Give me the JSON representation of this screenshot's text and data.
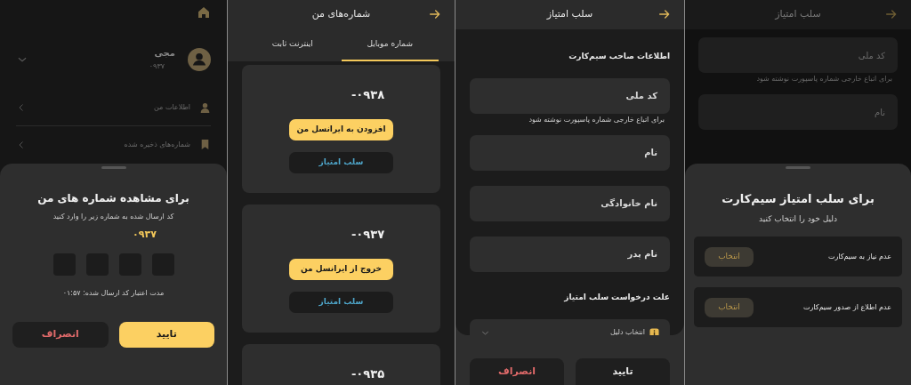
{
  "otp_screen": {
    "profile": {
      "name": "مجی",
      "phone": "۰۹۳۷"
    },
    "menu": [
      {
        "label": "اطلاعات من",
        "kind": "person"
      },
      {
        "label": "شماره‌های ذخیره شده",
        "kind": "bookmark"
      }
    ],
    "sheet": {
      "title": "برای مشاهده شماره های من",
      "subtitle": "کد ارسال شده به شماره زیر را وارد کنید",
      "phone": "۰۹۳۷",
      "timer": "مدت اعتبار کد ارسال شده: ۰۱:۵۷",
      "buttons": [
        {
          "label": "تایید",
          "kind": "primary"
        },
        {
          "label": "انصراف",
          "kind": "cancel"
        }
      ]
    }
  },
  "numbers_screen": {
    "title": "شماره‌های من",
    "tabs": [
      {
        "label": "شماره موبایل",
        "selected": true
      },
      {
        "label": "اینترنت ثابت",
        "selected": false
      }
    ],
    "cards": [
      {
        "number": "۰۹۳۸-",
        "actions": [
          "افزودن به ایرانسل من",
          "سلب امتیاز"
        ]
      },
      {
        "number": "۰۹۳۷-",
        "actions": [
          "خروج از ایرانسل من",
          "سلب امتیاز"
        ]
      },
      {
        "number": "۰۹۳۵-"
      }
    ]
  },
  "revoke_form_screen": {
    "title": "سلب امتیاز",
    "section": "اطلاعات صاحب سیم‌کارت",
    "fields": [
      {
        "placeholder": "کد ملی",
        "hint": "برای اتباع خارجی شماره پاسپورت نوشته شود"
      },
      {
        "placeholder": "نام"
      },
      {
        "placeholder": "نام خانوادگی"
      },
      {
        "placeholder": "نام پدر"
      }
    ],
    "reason_title": "علت درخواست سلب امتیاز",
    "reason_dropdown": {
      "placeholder": "انتخاب دلیل"
    },
    "buttons": [
      {
        "label": "تایید",
        "kind": "primary"
      },
      {
        "label": "انصراف",
        "kind": "cancel"
      }
    ]
  },
  "revoke_reason_screen": {
    "title": "سلب امتیاز",
    "fields": [
      {
        "placeholder": "کد ملی",
        "hint": "برای اتباع خارجی شماره پاسپورت نوشته شود"
      },
      {
        "placeholder": "نام"
      }
    ],
    "sheet": {
      "title": "برای سلب امتیاز سیم‌کارت",
      "subtitle": "دلیل خود را انتخاب کنید",
      "options": [
        {
          "label": "عدم نیاز به سیم‌کارت",
          "button": "انتخاب"
        },
        {
          "label": "عدم اطلاع از صدور سیم‌کارت",
          "button": "انتخاب"
        }
      ]
    }
  }
}
